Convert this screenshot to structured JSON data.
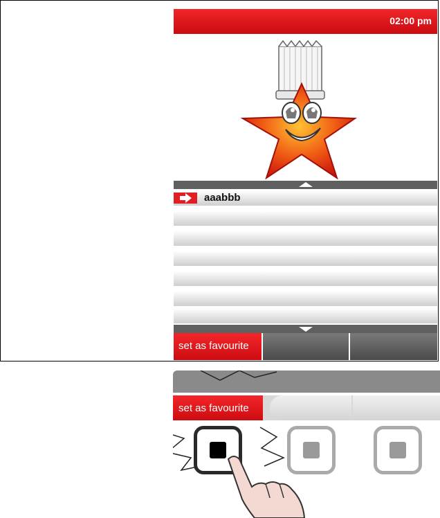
{
  "status_bar": {
    "time": "02:00 pm"
  },
  "mascot": {
    "name": "chef-star-mascot-icon"
  },
  "list": {
    "items": [
      {
        "label": "aaabbb",
        "selected": true
      },
      {
        "label": "",
        "selected": false
      },
      {
        "label": "",
        "selected": false
      },
      {
        "label": "",
        "selected": false
      },
      {
        "label": "",
        "selected": false
      },
      {
        "label": "",
        "selected": false
      },
      {
        "label": "",
        "selected": false
      },
      {
        "label": "",
        "selected": false
      }
    ]
  },
  "softkeys": [
    {
      "label": "set as favourite",
      "active": true
    },
    {
      "label": "",
      "active": false
    },
    {
      "label": "",
      "active": false
    }
  ],
  "illustration": {
    "softkey_label": "set as favourite",
    "hardware_buttons": [
      "pressed",
      "idle",
      "idle"
    ]
  },
  "colors": {
    "accent": "#e21e24",
    "dark": "#5f5f5f"
  }
}
